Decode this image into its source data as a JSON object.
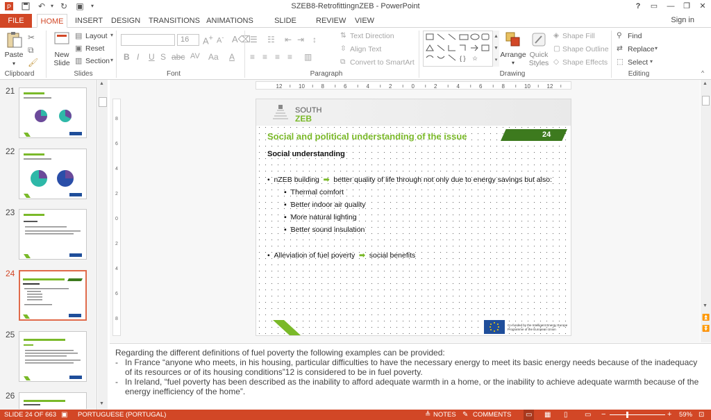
{
  "window": {
    "title": "SZEB8-RetrofittingnZEB - PowerPoint",
    "help": "?",
    "sign_in": "Sign in"
  },
  "tabs": [
    "FILE",
    "HOME",
    "INSERT",
    "DESIGN",
    "TRANSITIONS",
    "ANIMATIONS",
    "SLIDE SHOW",
    "REVIEW",
    "VIEW"
  ],
  "ribbon": {
    "clipboard": {
      "label": "Clipboard",
      "paste": "Paste"
    },
    "slides": {
      "label": "Slides",
      "new_slide_1": "New",
      "new_slide_2": "Slide",
      "layout": "Layout",
      "reset": "Reset",
      "section": "Section"
    },
    "font": {
      "label": "Font",
      "size": "16"
    },
    "paragraph": {
      "label": "Paragraph",
      "text_direction": "Text Direction",
      "align_text": "Align Text",
      "smartart": "Convert to SmartArt"
    },
    "drawing": {
      "label": "Drawing",
      "arrange": "Arrange",
      "quick_1": "Quick",
      "quick_2": "Styles",
      "fill": "Shape Fill",
      "outline": "Shape Outline",
      "effects": "Shape Effects"
    },
    "editing": {
      "label": "Editing",
      "find": "Find",
      "replace": "Replace",
      "select": "Select"
    }
  },
  "thumbnails": [
    "21",
    "22",
    "23",
    "24",
    "25",
    "26"
  ],
  "ruler": [
    "12",
    "10",
    "8",
    "6",
    "4",
    "2",
    "0",
    "2",
    "4",
    "6",
    "8",
    "10",
    "12"
  ],
  "slide": {
    "logo_top": "SOUTH",
    "logo_bottom": "ZEB",
    "title": "Social and political understanding of the issue",
    "number": "24",
    "subtitle": "Social understanding",
    "bullet1_a": "nZEB building",
    "bullet1_b": "better quality of life through not only due to energy savings but also:",
    "sub_bullets": [
      "Thermal comfort",
      "Better indoor air quality",
      "More natural lighting",
      "Better sound insulation"
    ],
    "bullet2_a": "Alleviation of fuel poverty",
    "bullet2_b": "social benefits",
    "eu_1": "Co-funded by the Intelligent Energy Europe",
    "eu_2": "Programme of the European Union"
  },
  "notes": {
    "line1": "Regarding the different definitions of fuel poverty the following examples can be provided:",
    "item1": "In France “anyone who meets, in his housing, particular difficulties to have the necessary energy to meet its basic energy needs because of the inadequacy of its resources or of its housing conditions”12 is considered to be in fuel poverty.",
    "item2": "In Ireland, “fuel poverty has been described as the inability to afford adequate warmth in a home, or the inability to achieve adequate warmth because of the energy inefficiency of the home”."
  },
  "status": {
    "slide": "SLIDE 24 OF 663",
    "language": "PORTUGUESE (PORTUGAL)",
    "notes": "NOTES",
    "comments": "COMMENTS",
    "zoom": "59%"
  },
  "colors": {
    "accent": "#d24726",
    "green": "#7ab929",
    "dark_green": "#3d7a1e"
  }
}
